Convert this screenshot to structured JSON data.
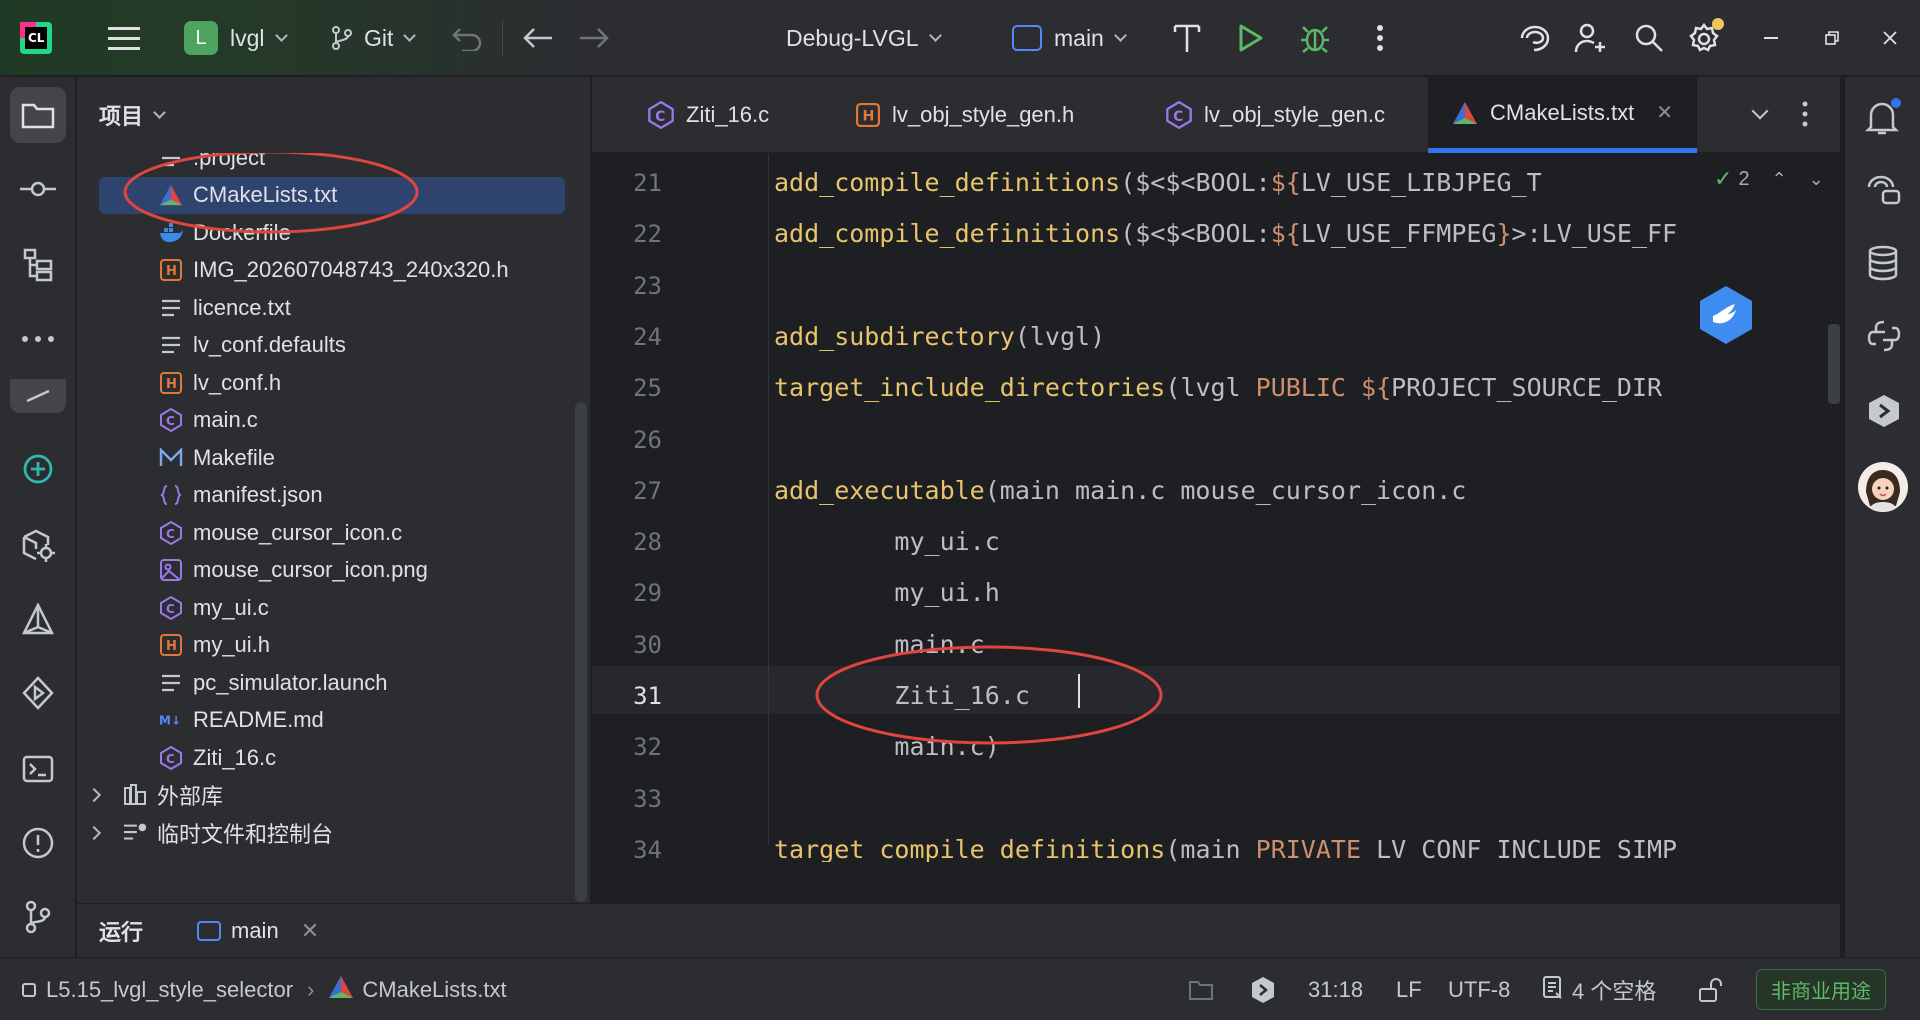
{
  "titlebar": {
    "project_letter": "L",
    "project_name": "lvgl",
    "vcs": "Git",
    "run_config": "Debug-LVGL",
    "target": "main"
  },
  "project_panel": {
    "title": "项目",
    "files": [
      {
        "name": ".project",
        "icon": "text-file-icon"
      },
      {
        "name": "CMakeLists.txt",
        "icon": "cmake-icon",
        "selected": true
      },
      {
        "name": "Dockerfile",
        "icon": "docker-icon"
      },
      {
        "name": "IMG_202607048743_240x320.h",
        "icon": "header-file-icon"
      },
      {
        "name": "licence.txt",
        "icon": "text-file-icon"
      },
      {
        "name": "lv_conf.defaults",
        "icon": "text-file-icon"
      },
      {
        "name": "lv_conf.h",
        "icon": "header-file-icon"
      },
      {
        "name": "main.c",
        "icon": "c-file-icon"
      },
      {
        "name": "Makefile",
        "icon": "makefile-icon"
      },
      {
        "name": "manifest.json",
        "icon": "json-file-icon"
      },
      {
        "name": "mouse_cursor_icon.c",
        "icon": "c-file-icon"
      },
      {
        "name": "mouse_cursor_icon.png",
        "icon": "image-file-icon"
      },
      {
        "name": "my_ui.c",
        "icon": "c-file-icon"
      },
      {
        "name": "my_ui.h",
        "icon": "header-file-icon"
      },
      {
        "name": "pc_simulator.launch",
        "icon": "text-file-icon"
      },
      {
        "name": "README.md",
        "icon": "markdown-file-icon"
      },
      {
        "name": "Ziti_16.c",
        "icon": "c-file-icon"
      }
    ],
    "groups": [
      {
        "name": "外部库",
        "icon": "library-icon"
      },
      {
        "name": "临时文件和控制台",
        "icon": "scratches-icon"
      }
    ]
  },
  "tabs": [
    {
      "label": "Ziti_16.c",
      "icon": "c-file-icon"
    },
    {
      "label": "lv_obj_style_gen.h",
      "icon": "header-file-icon"
    },
    {
      "label": "lv_obj_style_gen.c",
      "icon": "c-file-icon"
    },
    {
      "label": "CMakeLists.txt",
      "icon": "cmake-icon",
      "active": true
    }
  ],
  "editor": {
    "inspection_count": "2",
    "lines": [
      {
        "n": "21",
        "parts": [
          [
            "fn",
            "add_compile_definitions"
          ],
          [
            "ar",
            "($<$<BOOL:"
          ],
          [
            "kw",
            "${"
          ],
          [
            "ar",
            "LV_USE_LIBJPEG_T"
          ]
        ]
      },
      {
        "n": "22",
        "parts": [
          [
            "fn",
            "add_compile_definitions"
          ],
          [
            "ar",
            "($<$<BOOL:"
          ],
          [
            "kw",
            "${"
          ],
          [
            "ar",
            "LV_USE_FFMPEG"
          ],
          [
            "kw",
            "}"
          ],
          [
            "ar",
            ">:LV_USE_FF"
          ]
        ]
      },
      {
        "n": "23",
        "parts": []
      },
      {
        "n": "24",
        "parts": [
          [
            "fn",
            "add_subdirectory"
          ],
          [
            "ar",
            "(lvgl)"
          ]
        ]
      },
      {
        "n": "25",
        "parts": [
          [
            "fn",
            "target_include_directories"
          ],
          [
            "ar",
            "(lvgl "
          ],
          [
            "kw",
            "PUBLIC "
          ],
          [
            "kw",
            "${"
          ],
          [
            "ar",
            "PROJECT_SOURCE_DIR"
          ]
        ]
      },
      {
        "n": "26",
        "parts": []
      },
      {
        "n": "27",
        "parts": [
          [
            "fn",
            "add_executable"
          ],
          [
            "ar",
            "(main main.c mouse_cursor_icon.c"
          ]
        ]
      },
      {
        "n": "28",
        "parts": [
          [
            "ar",
            "        my_ui.c"
          ]
        ]
      },
      {
        "n": "29",
        "parts": [
          [
            "ar",
            "        my_ui.h"
          ]
        ]
      },
      {
        "n": "30",
        "parts": [
          [
            "ar",
            "        main.c"
          ]
        ]
      },
      {
        "n": "31",
        "parts": [
          [
            "ar",
            "        Ziti_16.c"
          ]
        ]
      },
      {
        "n": "32",
        "parts": [
          [
            "ar",
            "        main.c)"
          ]
        ]
      },
      {
        "n": "33",
        "parts": []
      },
      {
        "n": "34",
        "parts": [
          [
            "fn",
            "target_compile_definitions"
          ],
          [
            "ar",
            "(main "
          ],
          [
            "kw",
            "PRIVATE "
          ],
          [
            "ar",
            "LV_CONF_INCLUDE_SIMP"
          ]
        ]
      }
    ]
  },
  "runbar": {
    "label": "运行",
    "tab": "main"
  },
  "statusbar": {
    "project": "L5.15_lvgl_style_selector",
    "file": "CMakeLists.txt",
    "position": "31:18",
    "line_sep": "LF",
    "encoding": "UTF-8",
    "indent": "4 个空格",
    "license": "非商业用途"
  },
  "colors": {
    "accent": "#3574f0",
    "annotation_circle": "#e0463f",
    "keyword": "#cf8e6d",
    "function": "#e8c46c"
  }
}
